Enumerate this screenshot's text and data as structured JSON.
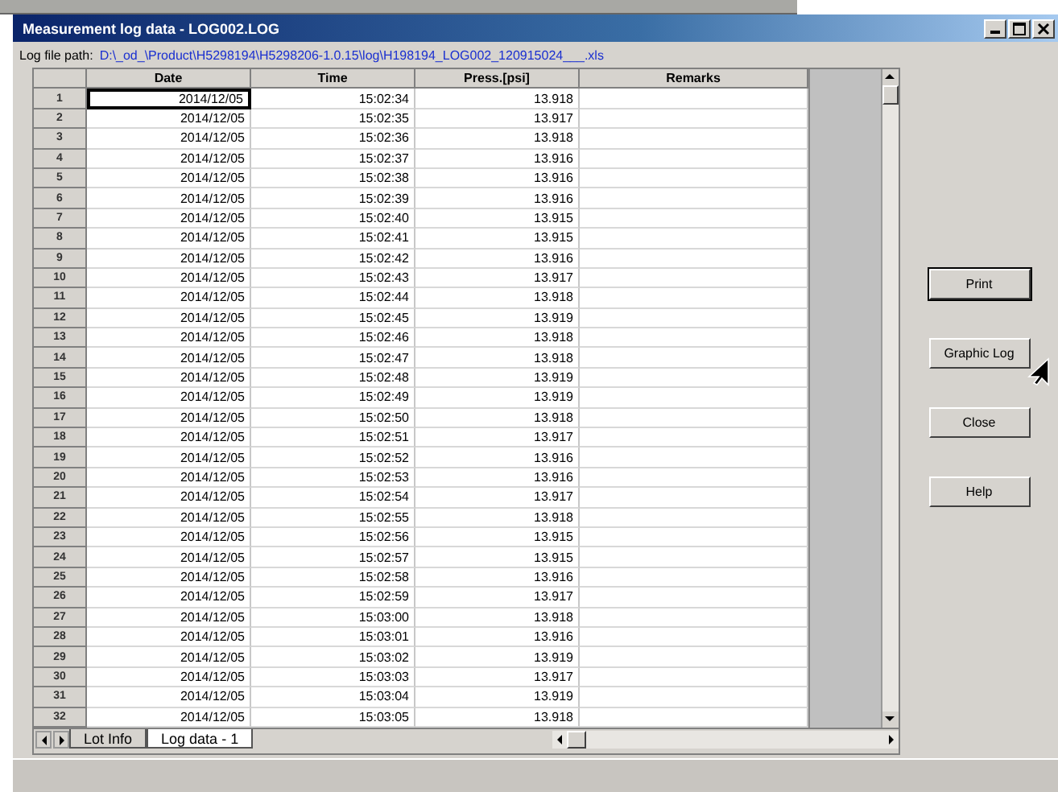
{
  "window": {
    "title": "Measurement log data - LOG002.LOG"
  },
  "log_file_path": {
    "label": "Log file path:",
    "value": "D:\\_od_\\Product\\H5298194\\H5298206-1.0.15\\log\\H198194_LOG002_120915024___.xls"
  },
  "table": {
    "columns": [
      "Date",
      "Time",
      "Press.[psi]",
      "Remarks"
    ],
    "rows": [
      {
        "number": "1",
        "date": "2014/12/05",
        "time": "15:02:34",
        "pressure": "13.918",
        "current": true
      },
      {
        "number": "2",
        "date": "2014/12/05",
        "time": "15:02:35",
        "pressure": "13.917",
        "current": false
      },
      {
        "number": "3",
        "date": "2014/12/05",
        "time": "15:02:36",
        "pressure": "13.918",
        "current": false
      },
      {
        "number": "4",
        "date": "2014/12/05",
        "time": "15:02:37",
        "pressure": "13.916",
        "current": false
      },
      {
        "number": "5",
        "date": "2014/12/05",
        "time": "15:02:38",
        "pressure": "13.916",
        "current": false
      },
      {
        "number": "6",
        "date": "2014/12/05",
        "time": "15:02:39",
        "pressure": "13.916",
        "current": false
      },
      {
        "number": "7",
        "date": "2014/12/05",
        "time": "15:02:40",
        "pressure": "13.915",
        "current": false
      },
      {
        "number": "8",
        "date": "2014/12/05",
        "time": "15:02:41",
        "pressure": "13.915",
        "current": false
      },
      {
        "number": "9",
        "date": "2014/12/05",
        "time": "15:02:42",
        "pressure": "13.916",
        "current": false
      },
      {
        "number": "10",
        "date": "2014/12/05",
        "time": "15:02:43",
        "pressure": "13.917",
        "current": false
      },
      {
        "number": "11",
        "date": "2014/12/05",
        "time": "15:02:44",
        "pressure": "13.918",
        "current": false
      },
      {
        "number": "12",
        "date": "2014/12/05",
        "time": "15:02:45",
        "pressure": "13.919",
        "current": false
      },
      {
        "number": "13",
        "date": "2014/12/05",
        "time": "15:02:46",
        "pressure": "13.918",
        "current": false
      },
      {
        "number": "14",
        "date": "2014/12/05",
        "time": "15:02:47",
        "pressure": "13.918",
        "current": false
      },
      {
        "number": "15",
        "date": "2014/12/05",
        "time": "15:02:48",
        "pressure": "13.919",
        "current": false
      },
      {
        "number": "16",
        "date": "2014/12/05",
        "time": "15:02:49",
        "pressure": "13.919",
        "current": false
      },
      {
        "number": "17",
        "date": "2014/12/05",
        "time": "15:02:50",
        "pressure": "13.918",
        "current": false
      },
      {
        "number": "18",
        "date": "2014/12/05",
        "time": "15:02:51",
        "pressure": "13.917",
        "current": false
      },
      {
        "number": "19",
        "date": "2014/12/05",
        "time": "15:02:52",
        "pressure": "13.916",
        "current": false
      },
      {
        "number": "20",
        "date": "2014/12/05",
        "time": "15:02:53",
        "pressure": "13.916",
        "current": false
      },
      {
        "number": "21",
        "date": "2014/12/05",
        "time": "15:02:54",
        "pressure": "13.917",
        "current": false
      },
      {
        "number": "22",
        "date": "2014/12/05",
        "time": "15:02:55",
        "pressure": "13.918",
        "current": false
      },
      {
        "number": "23",
        "date": "2014/12/05",
        "time": "15:02:56",
        "pressure": "13.915",
        "current": false
      },
      {
        "number": "24",
        "date": "2014/12/05",
        "time": "15:02:57",
        "pressure": "13.915",
        "current": false
      },
      {
        "number": "25",
        "date": "2014/12/05",
        "time": "15:02:58",
        "pressure": "13.916",
        "current": false
      },
      {
        "number": "26",
        "date": "2014/12/05",
        "time": "15:02:59",
        "pressure": "13.917",
        "current": false
      },
      {
        "number": "27",
        "date": "2014/12/05",
        "time": "15:03:00",
        "pressure": "13.918",
        "current": false
      },
      {
        "number": "28",
        "date": "2014/12/05",
        "time": "15:03:01",
        "pressure": "13.916",
        "current": false
      },
      {
        "number": "29",
        "date": "2014/12/05",
        "time": "15:03:02",
        "pressure": "13.919",
        "current": false
      },
      {
        "number": "30",
        "date": "2014/12/05",
        "time": "15:03:03",
        "pressure": "13.917",
        "current": false
      },
      {
        "number": "31",
        "date": "2014/12/05",
        "time": "15:03:04",
        "pressure": "13.919",
        "current": false
      },
      {
        "number": "32",
        "date": "2014/12/05",
        "time": "15:03:05",
        "pressure": "13.918",
        "current": false
      }
    ]
  },
  "sheet_tabs": [
    {
      "label": "Lot Info",
      "selected": false
    },
    {
      "label": "Log data - 1",
      "selected": true
    }
  ],
  "buttons": [
    {
      "label": "Print",
      "default": true
    },
    {
      "label": "Graphic Log",
      "default": false
    },
    {
      "label": "Close",
      "default": false
    },
    {
      "label": "Help",
      "default": false
    }
  ]
}
